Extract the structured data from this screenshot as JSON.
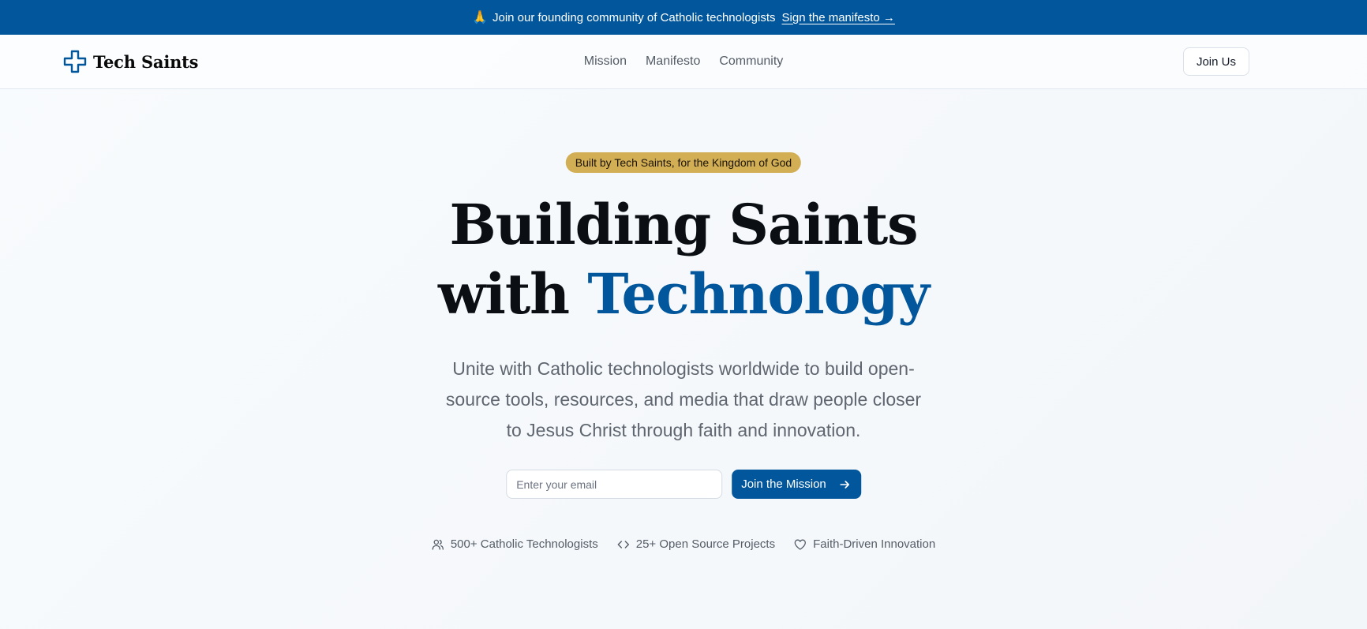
{
  "announcement": {
    "emoji": "🙏",
    "text": "Join our founding community of Catholic technologists",
    "link_label": "Sign the manifesto →"
  },
  "header": {
    "brand": {
      "name": "Tech Saints",
      "icon": "cross-icon"
    },
    "nav": [
      {
        "label": "Mission"
      },
      {
        "label": "Manifesto"
      },
      {
        "label": "Community"
      }
    ],
    "join_label": "Join Us"
  },
  "hero": {
    "badge": "Built by Tech Saints, for the Kingdom of God",
    "headline_line1": "Building Saints",
    "headline_line2_prefix": "with ",
    "headline_line2_accent": "Technology",
    "subtitle": "Unite with Catholic technologists worldwide to build open-source tools, resources, and media that draw people closer to Jesus Christ through faith and innovation.",
    "email_placeholder": "Enter your email",
    "cta_label": "Join the Mission",
    "cta_icon": "arrow-right-icon"
  },
  "stats": [
    {
      "icon": "users-icon",
      "label": "500+ Catholic Technologists"
    },
    {
      "icon": "code-icon",
      "label": "25+ Open Source Projects"
    },
    {
      "icon": "heart-icon",
      "label": "Faith-Driven Innovation"
    }
  ],
  "colors": {
    "primary": "#02579c",
    "badge": "#d2ae55",
    "muted_text": "#5f6670"
  }
}
